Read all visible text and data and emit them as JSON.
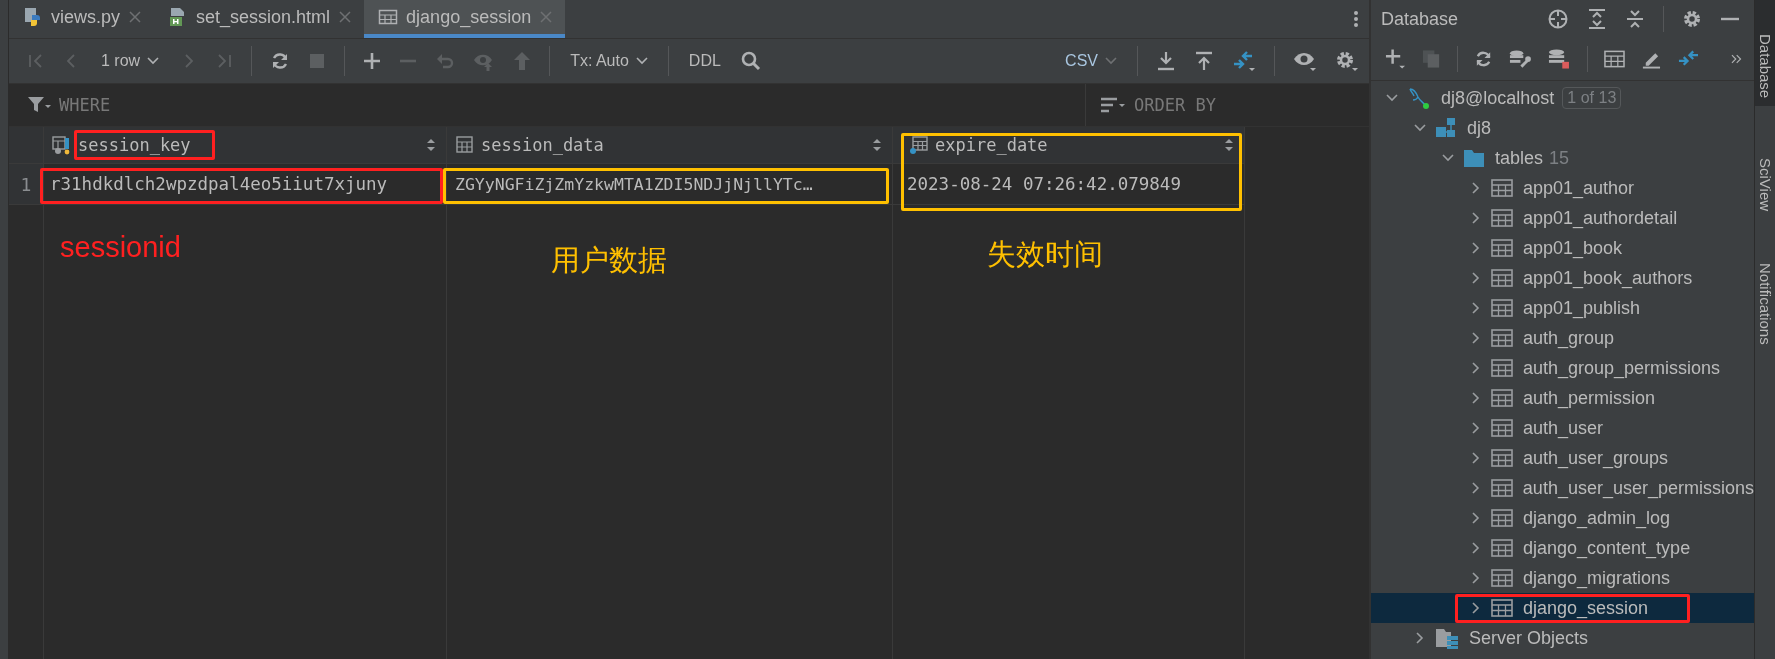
{
  "editor_tabs": [
    {
      "label": "views.py",
      "kind": "python",
      "selected": false
    },
    {
      "label": "set_session.html",
      "kind": "html",
      "selected": false
    },
    {
      "label": "django_session",
      "kind": "table",
      "selected": true
    }
  ],
  "toolbar": {
    "row_count": "1 row",
    "tx_mode": "Tx: Auto",
    "ddl": "DDL",
    "export_format": "CSV"
  },
  "filter": {
    "where": "WHERE",
    "order_by": "ORDER BY"
  },
  "table": {
    "row_numbers": [
      "1"
    ],
    "columns": [
      {
        "name": "session_key",
        "kind": "key",
        "header_box": {
          "color": "#ff2020"
        },
        "cell_box": {
          "color": "#ff2020"
        },
        "note": {
          "text": "sessionid",
          "color": "#ff2020"
        },
        "cells": [
          "r31hdkdlch2wpzdpal4eo5iiut7xjuny"
        ]
      },
      {
        "name": "session_data",
        "kind": "plain",
        "cell_box": {
          "color": "#ffc000"
        },
        "note": {
          "text": "用户数据",
          "color": "#ffc000"
        },
        "cells": [
          "ZGYyNGFiZjZmYzkwMTA1ZDI5NDJjNjllYTc…"
        ]
      },
      {
        "name": "expire_date",
        "kind": "indexed",
        "column_box": {
          "color": "#ffc000"
        },
        "note": {
          "text": "失效时间",
          "color": "#ffc000"
        },
        "cells": [
          "2023-08-24 07:26:42.079849"
        ]
      }
    ]
  },
  "database": {
    "title": "Database",
    "tree": [
      {
        "label": "dj8@localhost",
        "kind": "connection",
        "badge": "1 of 13",
        "expanded": true,
        "selected": false,
        "children": [
          {
            "label": "dj8",
            "kind": "schema",
            "expanded": true,
            "selected": false,
            "children": [
              {
                "label": "tables",
                "kind": "folder",
                "count": "15",
                "expanded": true,
                "selected": false,
                "children": [
                  {
                    "label": "app01_author",
                    "kind": "table",
                    "expanded": false,
                    "selected": false
                  },
                  {
                    "label": "app01_authordetail",
                    "kind": "table",
                    "expanded": false,
                    "selected": false
                  },
                  {
                    "label": "app01_book",
                    "kind": "table",
                    "expanded": false,
                    "selected": false
                  },
                  {
                    "label": "app01_book_authors",
                    "kind": "table",
                    "expanded": false,
                    "selected": false
                  },
                  {
                    "label": "app01_publish",
                    "kind": "table",
                    "expanded": false,
                    "selected": false
                  },
                  {
                    "label": "auth_group",
                    "kind": "table",
                    "expanded": false,
                    "selected": false
                  },
                  {
                    "label": "auth_group_permissions",
                    "kind": "table",
                    "expanded": false,
                    "selected": false
                  },
                  {
                    "label": "auth_permission",
                    "kind": "table",
                    "expanded": false,
                    "selected": false
                  },
                  {
                    "label": "auth_user",
                    "kind": "table",
                    "expanded": false,
                    "selected": false
                  },
                  {
                    "label": "auth_user_groups",
                    "kind": "table",
                    "expanded": false,
                    "selected": false
                  },
                  {
                    "label": "auth_user_user_permissions",
                    "kind": "table",
                    "expanded": false,
                    "selected": false
                  },
                  {
                    "label": "django_admin_log",
                    "kind": "table",
                    "expanded": false,
                    "selected": false
                  },
                  {
                    "label": "django_content_type",
                    "kind": "table",
                    "expanded": false,
                    "selected": false
                  },
                  {
                    "label": "django_migrations",
                    "kind": "table",
                    "expanded": false,
                    "selected": false
                  },
                  {
                    "label": "django_session",
                    "kind": "table",
                    "expanded": false,
                    "selected": true,
                    "box": {
                      "color": "#ff2020"
                    }
                  }
                ]
              }
            ]
          },
          {
            "label": "Server Objects",
            "kind": "server",
            "expanded": false,
            "selected": false
          }
        ]
      }
    ]
  },
  "side_tools": [
    {
      "label": "Database",
      "selected": true
    },
    {
      "label": "SciView",
      "selected": false
    },
    {
      "label": "Notifications",
      "selected": false
    }
  ]
}
